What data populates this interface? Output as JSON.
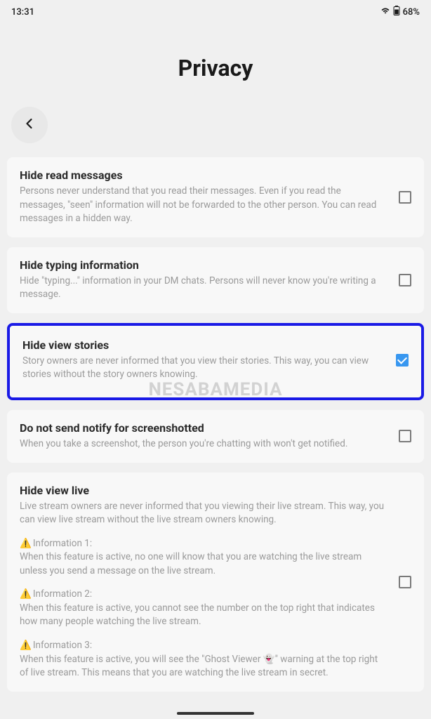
{
  "status_bar": {
    "time": "13:31",
    "battery_text": "68%"
  },
  "page": {
    "title": "Privacy"
  },
  "watermark": "NESABAMEDIA",
  "settings": [
    {
      "title": "Hide read messages",
      "desc": "Persons never understand that you read their messages. Even if you read the messages, \"seen\" information will not be forwarded to the other person. You can read messages in a hidden way.",
      "checked": false,
      "highlighted": false
    },
    {
      "title": "Hide typing information",
      "desc": "Hide \"typing...\" information in your DM chats. Persons will never know you're writing a message.",
      "checked": false,
      "highlighted": false
    },
    {
      "title": "Hide view stories",
      "desc": "Story owners are never informed that you view their stories. This way, you can view stories without the story owners knowing.",
      "checked": true,
      "highlighted": true
    },
    {
      "title": "Do not send notify for screenshotted",
      "desc": "When you take a screenshot, the person you're chatting with won't get notified.",
      "checked": false,
      "highlighted": false
    },
    {
      "title": "Hide view live",
      "desc": "Live stream owners are never informed that you viewing their live stream. This way, you can view live stream without the live stream owners knowing.",
      "checked": false,
      "highlighted": false,
      "infos": [
        {
          "label": "Information 1:",
          "text": "When this feature is active, no one will know that you are watching the live stream unless you send a message on the live stream."
        },
        {
          "label": "Information 2:",
          "text": "When this feature is active, you cannot see the number on the top right that indicates how many people watching the live stream."
        },
        {
          "label": "Information 3:",
          "text": "When this feature is active, you will see the \"Ghost Viewer 👻\" warning at the top right of live stream. This means that you are watching the live stream in secret."
        }
      ]
    }
  ]
}
